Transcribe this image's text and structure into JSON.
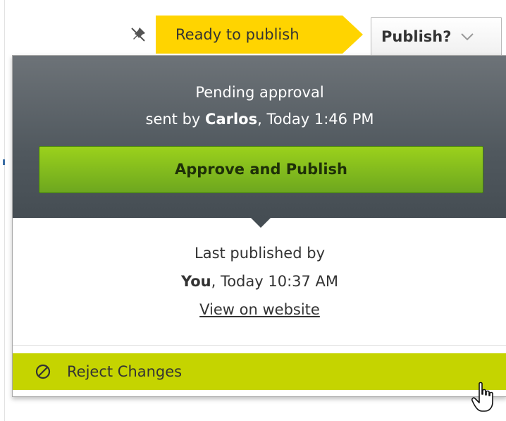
{
  "toolbar": {
    "status_label": "Ready to publish",
    "publish_label": "Publish?"
  },
  "panel": {
    "pending_title": "Pending approval",
    "sent_by_prefix": "sent by ",
    "sent_by_user": "Carlos",
    "sent_by_time": ", Today 1:46 PM",
    "approve_label": "Approve and Publish",
    "last_published_label": "Last published by",
    "last_published_user": "You",
    "last_published_time": ", Today 10:37 AM",
    "view_link_label": "View on website",
    "reject_label": "Reject Changes"
  },
  "colors": {
    "status_ribbon": "#ffd400",
    "approve_button": "#8cc31e",
    "reject_bar": "#c5d400",
    "dark_header": "#50585e"
  },
  "icons": {
    "pin": "pin-off-icon",
    "chevron": "chevron-down-icon",
    "reject": "forbidden-icon",
    "cursor": "hand-pointer-cursor"
  }
}
